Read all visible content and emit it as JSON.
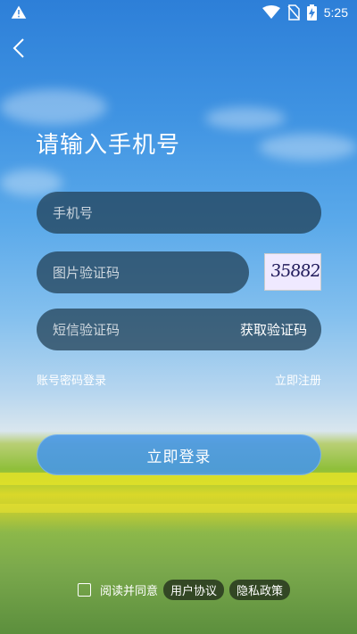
{
  "status_bar": {
    "time": "5:25"
  },
  "page": {
    "title": "请输入手机号"
  },
  "phone": {
    "placeholder": "手机号"
  },
  "image_code": {
    "placeholder": "图片验证码",
    "captcha_text": "35882"
  },
  "sms_code": {
    "placeholder": "短信验证码",
    "get_code_label": "获取验证码"
  },
  "links": {
    "password_login": "账号密码登录",
    "register": "立即注册"
  },
  "login_button": "立即登录",
  "agreement": {
    "text": "阅读并同意",
    "user_agreement": "用户协议",
    "privacy_policy": "隐私政策"
  },
  "icons": {
    "status_warning": "warning-icon",
    "wifi": "wifi-icon",
    "no_sim": "no-sim-icon",
    "battery": "battery-charging-icon",
    "back": "back-arrow-icon"
  }
}
